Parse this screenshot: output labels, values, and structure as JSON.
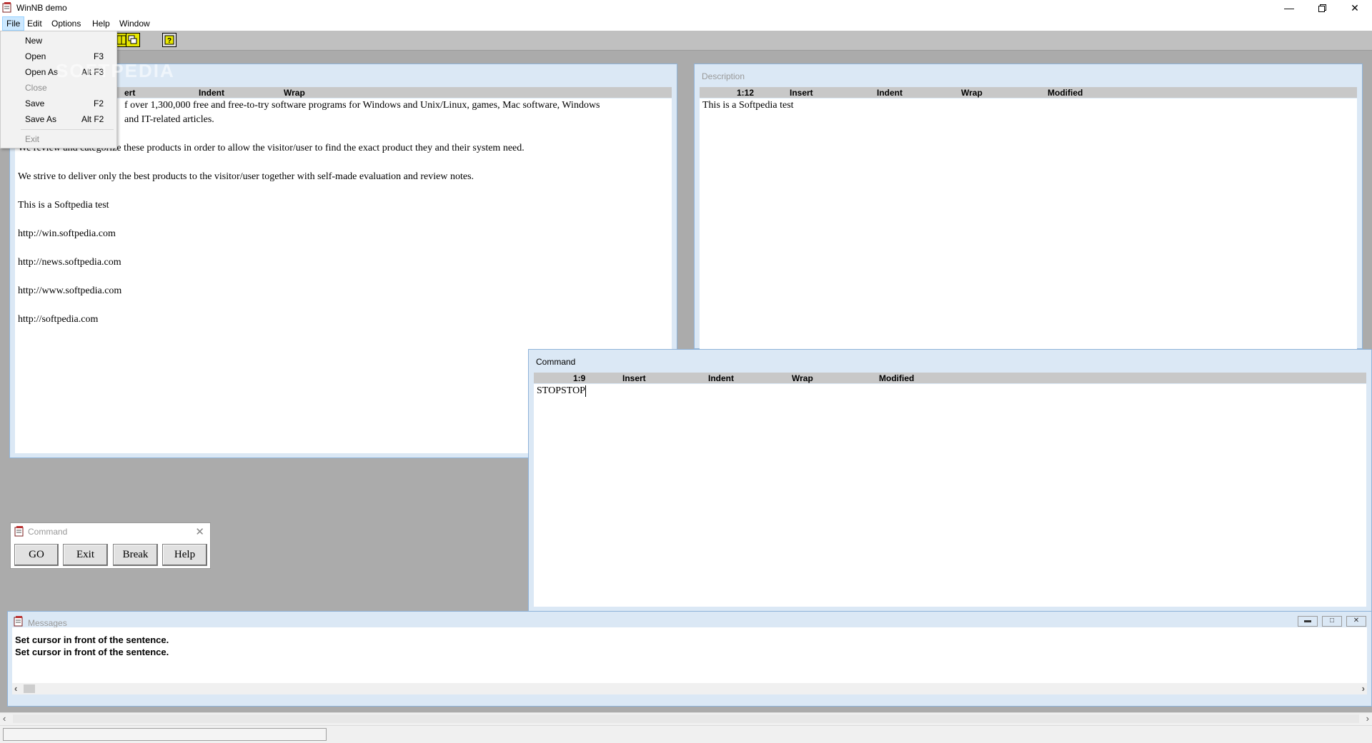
{
  "app": {
    "title": "WinNB demo"
  },
  "menubar": [
    "File",
    "Edit",
    "Options",
    "Help",
    "Window"
  ],
  "file_menu": {
    "items": [
      {
        "label": "New",
        "shortcut": "",
        "enabled": true
      },
      {
        "label": "Open",
        "shortcut": "F3",
        "enabled": true
      },
      {
        "label": "Open As",
        "shortcut": "Alt F3",
        "enabled": true
      },
      {
        "label": "Close",
        "shortcut": "",
        "enabled": false
      },
      {
        "label": "Save",
        "shortcut": "F2",
        "enabled": true
      },
      {
        "label": "Save As",
        "shortcut": "Alt F2",
        "enabled": true
      },
      {
        "label": "Exit",
        "shortcut": "",
        "enabled": false
      }
    ]
  },
  "editor_window": {
    "header": {
      "mode": "ert",
      "indent": "Indent",
      "wrap": "Wrap"
    },
    "partial_line1": "f over 1,300,000 free and free-to-try software programs for Windows and Unix/Linux, games, Mac software, Windows",
    "partial_line2": "and IT-related articles.",
    "paragraphs": [
      "We review and categorize these products in order to allow the visitor/user to find the exact product they and their system need.",
      "We strive to deliver only the best products to the visitor/user together with self-made evaluation and review notes.",
      "This is a Softpedia test",
      "http://win.softpedia.com",
      "http://news.softpedia.com",
      "http://www.softpedia.com",
      "http://softpedia.com"
    ]
  },
  "description_window": {
    "title": "Description",
    "header": {
      "position": "1:12",
      "mode": "Insert",
      "indent": "Indent",
      "wrap": "Wrap",
      "modified": "Modified"
    },
    "text": "This is a Softpedia test"
  },
  "command_window": {
    "title": "Command",
    "header": {
      "position": "1:9",
      "mode": "Insert",
      "indent": "Indent",
      "wrap": "Wrap",
      "modified": "Modified"
    },
    "text": "STOPSTOP"
  },
  "command_palette": {
    "title": "Command",
    "buttons": [
      "GO",
      "Exit",
      "Break",
      "Help"
    ]
  },
  "messages": {
    "title": "Messages",
    "lines": [
      "Set cursor in front of the sentence.",
      "Set cursor in front of the sentence."
    ]
  },
  "watermark": "SOFTPEDIA"
}
